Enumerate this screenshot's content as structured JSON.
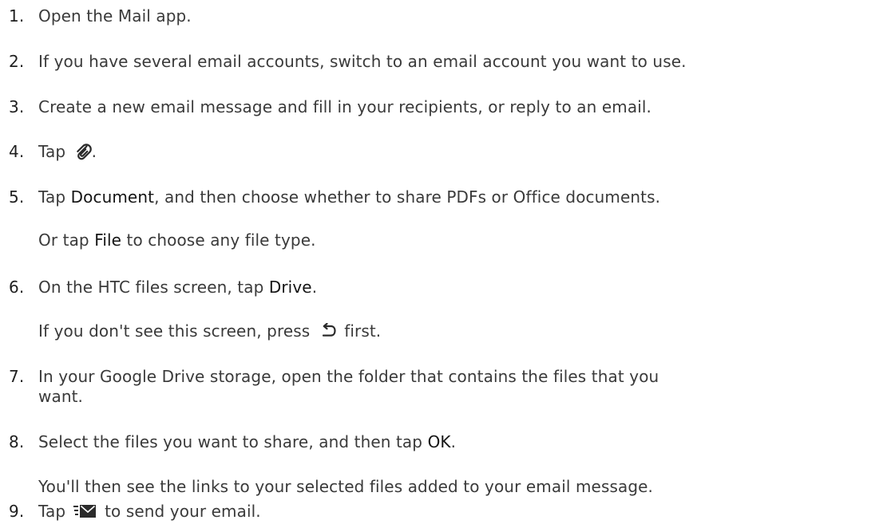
{
  "steps": [
    {
      "num": "1.",
      "text": "Open the Mail app."
    },
    {
      "num": "2.",
      "text": "If you have several email accounts, switch to an email account you want to use."
    },
    {
      "num": "3.",
      "text": "Create a new email message and fill in your recipients, or reply to an email."
    },
    {
      "num": "4.",
      "before": "Tap",
      "icon": "paperclip-icon",
      "after": "."
    },
    {
      "num": "5.",
      "before": "Tap",
      "bold": "Document",
      "after": ", and then choose whether to share PDFs or Office documents."
    },
    {
      "num": "6.",
      "before": "On the HTC files screen, tap",
      "bold": "Drive",
      "after": "."
    },
    {
      "num": "7.",
      "line1": "In your Google Drive storage, open the folder that contains the files that you",
      "line2": "want."
    },
    {
      "num": "8.",
      "before": "Select the files you want to share, and then tap",
      "bold": "OK",
      "after": "."
    },
    {
      "num": "9.",
      "before": "Tap",
      "icon": "send-mail-icon",
      "after": "to send your email."
    }
  ],
  "notes": {
    "step5": {
      "before": "Or tap",
      "bold": "File",
      "after": "to choose any file type."
    },
    "step6": {
      "before": "If you don't see this screen, press",
      "icon": "back-arrow-icon",
      "after": "first."
    },
    "step8": {
      "text": "You'll then see the links to your selected files added to your email message."
    }
  }
}
